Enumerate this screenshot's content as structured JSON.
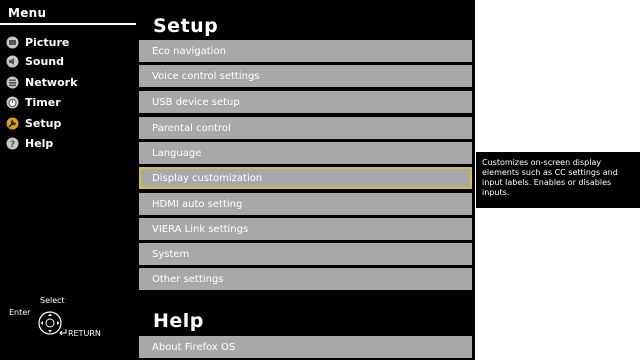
{
  "menu": {
    "title": "Menu",
    "items": [
      {
        "label": "Picture",
        "icon": "picture-icon"
      },
      {
        "label": "Sound",
        "icon": "sound-icon"
      },
      {
        "label": "Network",
        "icon": "network-icon"
      },
      {
        "label": "Timer",
        "icon": "timer-icon"
      },
      {
        "label": "Setup",
        "icon": "setup-icon"
      },
      {
        "label": "Help",
        "icon": "help-icon"
      }
    ]
  },
  "setup": {
    "title": "Setup",
    "items": [
      "Eco navigation",
      "Voice control settings",
      "USB device setup",
      "Parental control",
      "Language",
      "Display customization",
      "HDMI auto setting",
      "VIERA Link settings",
      "System",
      "Other settings"
    ],
    "selected_index": 5
  },
  "help": {
    "title": "Help",
    "items": [
      "About Firefox OS"
    ]
  },
  "description": "Customizes on-screen display elements such as CC settings and input labels.  Enables or disables inputs.",
  "controls": {
    "select_label": "Select",
    "enter_label": "Enter",
    "return_label": "RETURN"
  },
  "colors": {
    "background": "#000000",
    "row": "#a8a8a8",
    "selected_outline": "#d8c42a"
  }
}
